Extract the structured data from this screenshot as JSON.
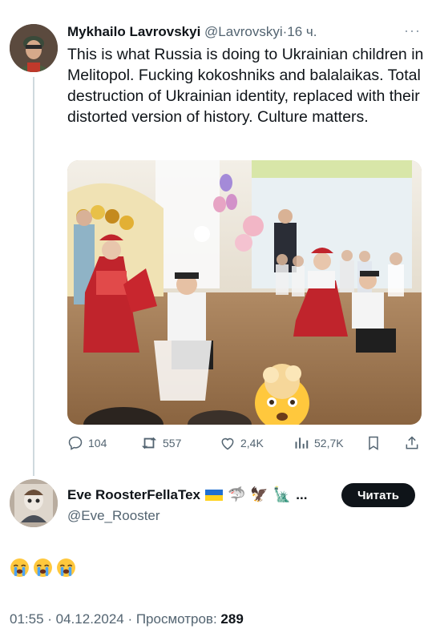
{
  "tweet": {
    "author_name": "Mykhailo Lavrovskyi",
    "author_handle": "@Lavrovskyi",
    "separator": "·",
    "time": "16 ч.",
    "text": "This is what Russia is doing to Ukrainian children in Melitopol. Fucking kokoshniks and balalaikas. Total destruction of Ukrainian identity, replaced with their distorted version of history. Culture matters.",
    "more_icon": "ellipsis-icon"
  },
  "actions": {
    "replies": "104",
    "reposts": "557",
    "likes": "2,4K",
    "views": "52,7K"
  },
  "reply": {
    "author_name": "Eve RoosterFellaTex",
    "author_handle": "@Eve_Rooster",
    "name_suffix": "...",
    "follow_label": "Читать",
    "emojis": [
      "loudly-crying-face",
      "loudly-crying-face",
      "loudly-crying-face"
    ]
  },
  "footer": {
    "datetime": "01:55 · 04.12.2024 · Просмотров:",
    "views": "289"
  },
  "colors": {
    "text": "#0f1419",
    "muted": "#536471",
    "line": "#cfd9de",
    "button": "#0f1419"
  }
}
